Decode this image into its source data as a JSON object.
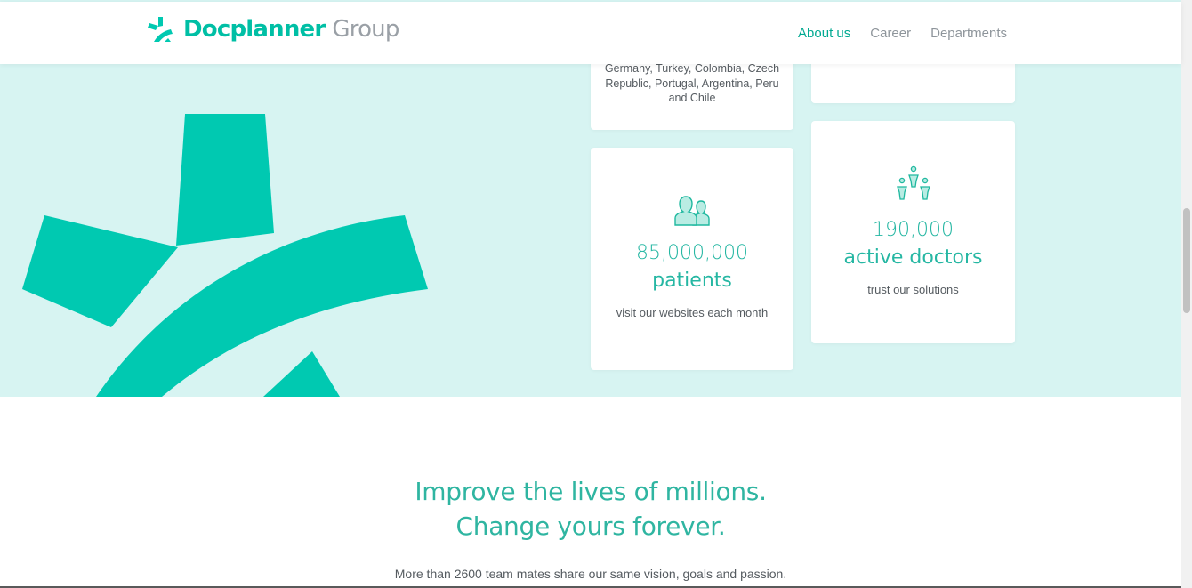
{
  "colors": {
    "brand": "#00C9B1",
    "brand_text": "#00bfa5",
    "hero_bg": "#d7f4f2",
    "nav_active": "#00a991",
    "nav_inactive": "#8e959b",
    "top_border": "#7b55a8"
  },
  "header": {
    "brand_primary": "Docplanner",
    "brand_secondary": "Group",
    "nav": [
      {
        "label": "About us",
        "active": true
      },
      {
        "label": "Career",
        "active": false
      },
      {
        "label": "Departments",
        "active": false
      }
    ]
  },
  "stats": {
    "countries_text": "Germany, Turkey, Colombia, Czech Republic, Portugal, Argentina, Peru and Chile",
    "patients": {
      "icon": "patients-icon",
      "number": "85,000,000",
      "label": "patients",
      "caption": "visit our websites each month"
    },
    "doctors": {
      "icon": "doctors-icon",
      "number": "190,000",
      "label": "active doctors",
      "caption": "trust our solutions"
    }
  },
  "mission": {
    "headline_line1": "Improve the lives of millions.",
    "headline_line2": "Change yours forever.",
    "subtext": "More than 2600 team mates share our same vision, goals and passion."
  }
}
